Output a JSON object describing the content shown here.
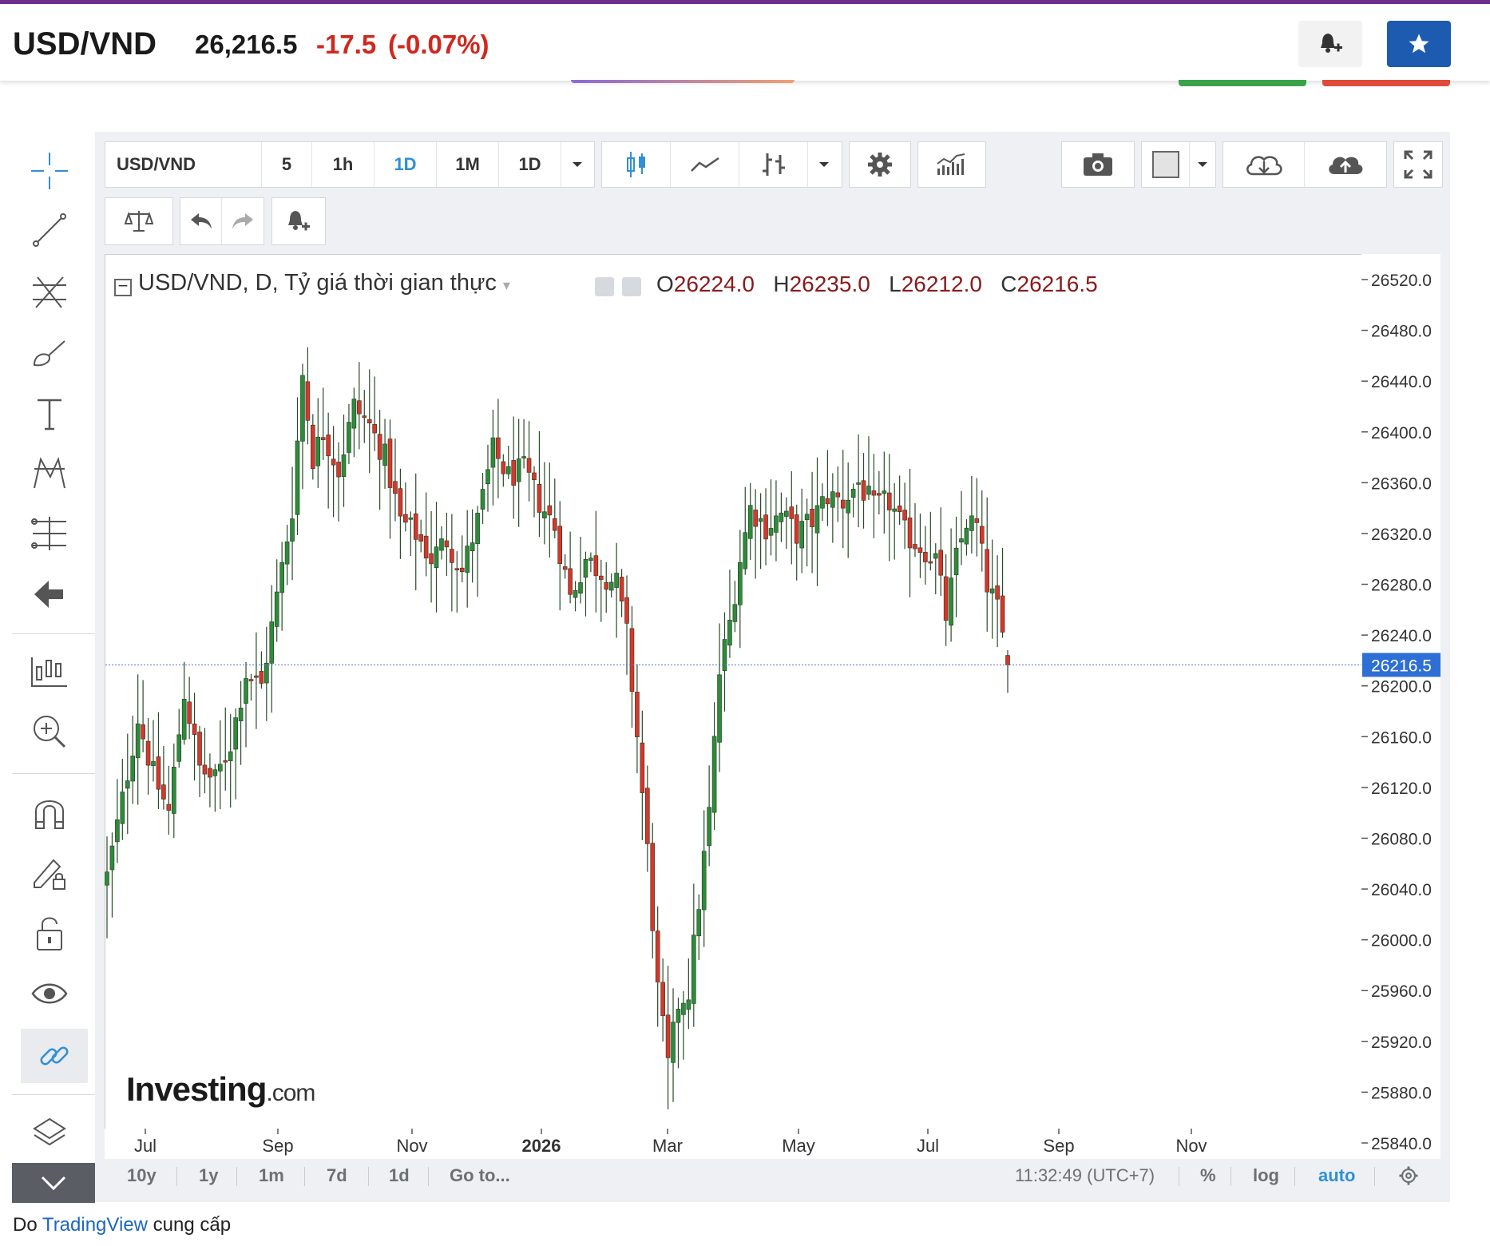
{
  "header": {
    "symbol": "USD/VND",
    "price": "26,216.5",
    "change": "-17.5",
    "change_pct": "(-0.07%)",
    "bell_icon": "bell-plus-icon",
    "star_icon": "star-icon"
  },
  "toolbar": {
    "symbol": "USD/VND",
    "intervals": [
      "5",
      "1h",
      "1D",
      "1M",
      "1D"
    ],
    "active_interval": "1D",
    "icons": [
      "chevron-down-icon",
      "candlestick-icon",
      "line-chart-icon",
      "bar-style-icon",
      "chevron-down-icon",
      "gear-icon",
      "indicators-icon",
      "camera-icon",
      "color-swatch-icon",
      "chevron-down-icon",
      "cloud-download-icon",
      "cloud-upload-icon",
      "fullscreen-icon"
    ],
    "row2_icons": [
      "compare-scale-icon",
      "undo-icon",
      "redo-icon",
      "alert-bell-icon"
    ]
  },
  "left_tools": [
    "crosshair-icon",
    "trendline-icon",
    "fib-icon",
    "brush-icon",
    "text-icon",
    "pattern-icon",
    "measure-icon",
    "back-arrow-icon",
    "long-position-icon",
    "zoom-in-icon",
    "magnet-icon",
    "lock-drawing-icon",
    "unlock-icon",
    "eye-icon",
    "link-icon",
    "layers-icon",
    "collapse-icon"
  ],
  "legend": {
    "title": "USD/VND, D, Tỷ giá thời gian thực",
    "o_label": "O",
    "o": "26224.0",
    "h_label": "H",
    "h": "26235.0",
    "l_label": "L",
    "l": "26212.0",
    "c_label": "C",
    "c": "26216.5"
  },
  "watermark": {
    "brand": "Investing",
    "suffix": ".com"
  },
  "bottom_bar": {
    "ranges": [
      "10y",
      "1y",
      "1m",
      "7d",
      "1d"
    ],
    "goto": "Go to...",
    "time": "11:32:49 (UTC+7)",
    "percent": "%",
    "log": "log",
    "auto": "auto"
  },
  "footer": {
    "prefix": "Do",
    "link": "TradingView",
    "suffix": "cung cấp"
  },
  "colors": {
    "up": "#2e8b3a",
    "down": "#d9352a",
    "price_line": "#5b6ed8",
    "price_tag": "#2e6fd6"
  },
  "chart_data": {
    "type": "candlestick",
    "title": "USD/VND, D, Tỷ giá thời gian thực",
    "yticks": [
      26520.0,
      26480.0,
      26440.0,
      26400.0,
      26360.0,
      26320.0,
      26280.0,
      26240.0,
      26200.0,
      26160.0,
      26120.0,
      26080.0,
      26040.0,
      26000.0,
      25960.0,
      25920.0,
      25880.0,
      25840.0
    ],
    "ylim": [
      25810,
      26530
    ],
    "xticks": [
      "Jul",
      "Sep",
      "Nov",
      "2026",
      "Mar",
      "May",
      "Jul",
      "Sep",
      "Nov"
    ],
    "last_price": 26216.5,
    "last_price_label": "26216.5",
    "close_path": [
      [
        0,
        26050
      ],
      [
        3,
        26110
      ],
      [
        6,
        26175
      ],
      [
        9,
        26130
      ],
      [
        12,
        26100
      ],
      [
        15,
        26195
      ],
      [
        18,
        26135
      ],
      [
        21,
        26125
      ],
      [
        24,
        26155
      ],
      [
        27,
        26210
      ],
      [
        30,
        26200
      ],
      [
        33,
        26270
      ],
      [
        36,
        26340
      ],
      [
        38,
        26445
      ],
      [
        40,
        26380
      ],
      [
        42,
        26400
      ],
      [
        45,
        26370
      ],
      [
        48,
        26420
      ],
      [
        51,
        26405
      ],
      [
        54,
        26380
      ],
      [
        57,
        26330
      ],
      [
        60,
        26320
      ],
      [
        63,
        26300
      ],
      [
        66,
        26315
      ],
      [
        69,
        26290
      ],
      [
        72,
        26330
      ],
      [
        75,
        26385
      ],
      [
        78,
        26365
      ],
      [
        81,
        26370
      ],
      [
        84,
        26345
      ],
      [
        87,
        26325
      ],
      [
        90,
        26270
      ],
      [
        93,
        26300
      ],
      [
        96,
        26290
      ],
      [
        99,
        26280
      ],
      [
        101,
        26240
      ],
      [
        103,
        26160
      ],
      [
        105,
        26070
      ],
      [
        107,
        25960
      ],
      [
        109,
        25900
      ],
      [
        111,
        25950
      ],
      [
        113,
        25960
      ],
      [
        115,
        26030
      ],
      [
        117,
        26100
      ],
      [
        119,
        26210
      ],
      [
        121,
        26250
      ],
      [
        123,
        26300
      ],
      [
        125,
        26340
      ],
      [
        128,
        26325
      ],
      [
        131,
        26335
      ],
      [
        134,
        26320
      ],
      [
        137,
        26330
      ],
      [
        140,
        26350
      ],
      [
        143,
        26345
      ],
      [
        146,
        26360
      ],
      [
        149,
        26340
      ],
      [
        152,
        26345
      ],
      [
        155,
        26320
      ],
      [
        158,
        26310
      ],
      [
        161,
        26300
      ],
      [
        163,
        26255
      ],
      [
        165,
        26300
      ],
      [
        167,
        26330
      ],
      [
        169,
        26325
      ],
      [
        171,
        26280
      ],
      [
        173,
        26260
      ],
      [
        175,
        26216.5
      ]
    ],
    "n_candles": 176
  }
}
